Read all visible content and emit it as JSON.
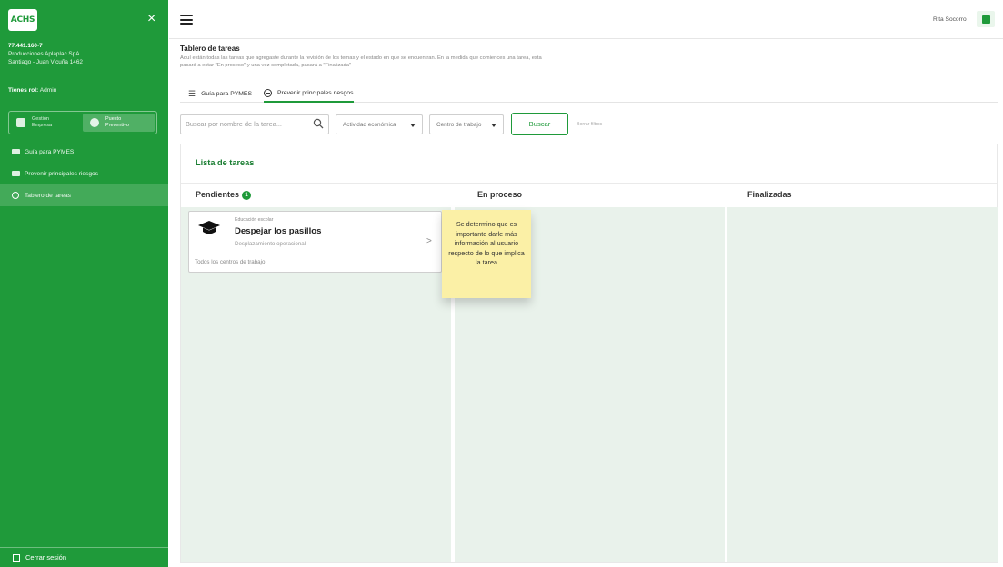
{
  "sidebar": {
    "logo_text": "ACHS",
    "close_label": "×",
    "company": {
      "rut": "77.441.160-7",
      "name": "Producciones Aplaplac SpA",
      "address": "Santiago - Juan Vicuña 1462"
    },
    "role_label": "Tienes rol:",
    "role_value": "Admin",
    "toggle": [
      {
        "line1": "Gestión",
        "line2": "Empresa",
        "active": false
      },
      {
        "line1": "Puesto",
        "line2": "Preventivo",
        "active": true
      }
    ],
    "nav": [
      {
        "label": "Guía para PYMES",
        "icon": "folder-icon"
      },
      {
        "label": "Prevenir principales riesgos",
        "icon": "folder-icon"
      },
      {
        "label": "Tablero de tareas",
        "icon": "minus-circle-icon",
        "active": true
      }
    ],
    "logout_label": "Cerrar sesión"
  },
  "topbar": {
    "user_name": "Rita Socorro"
  },
  "header": {
    "title": "Tablero de tareas",
    "description": "Aquí están todas las tareas que agregaste durante la revisión de los temas y el estado en que se encuentran. En la medida que comiences una tarea, esta pasará a estar \"En proceso\" y una vez completada, pasará a \"Finalizada\""
  },
  "tabs": [
    {
      "label": "Guía para PYMES",
      "active": false
    },
    {
      "label": "Prevenir principales riesgos",
      "active": true
    }
  ],
  "filters": {
    "search_placeholder": "Buscar por nombre de la tarea...",
    "select_activity": "Actividad económica",
    "select_center": "Centro de trabajo",
    "search_button": "Buscar",
    "clear_filters": "Borrar filtros"
  },
  "board": {
    "title": "Lista de tareas",
    "columns": [
      {
        "title": "Pendientes",
        "badge": "1"
      },
      {
        "title": "En proceso"
      },
      {
        "title": "Finalizadas"
      }
    ]
  },
  "task": {
    "category": "Educación escolar",
    "title": "Despejar los pasillos",
    "subtitle": "Desplazamiento operacional",
    "footer": "Todos los centros de trabajo"
  },
  "sticky_note": "Se determino que es importante darle más información al usuario respecto de lo que implica la tarea",
  "colors": {
    "brand_green": "#1f9a3a",
    "column_bg": "#e9f2eb",
    "sticky_yellow": "#fbf0a6"
  }
}
